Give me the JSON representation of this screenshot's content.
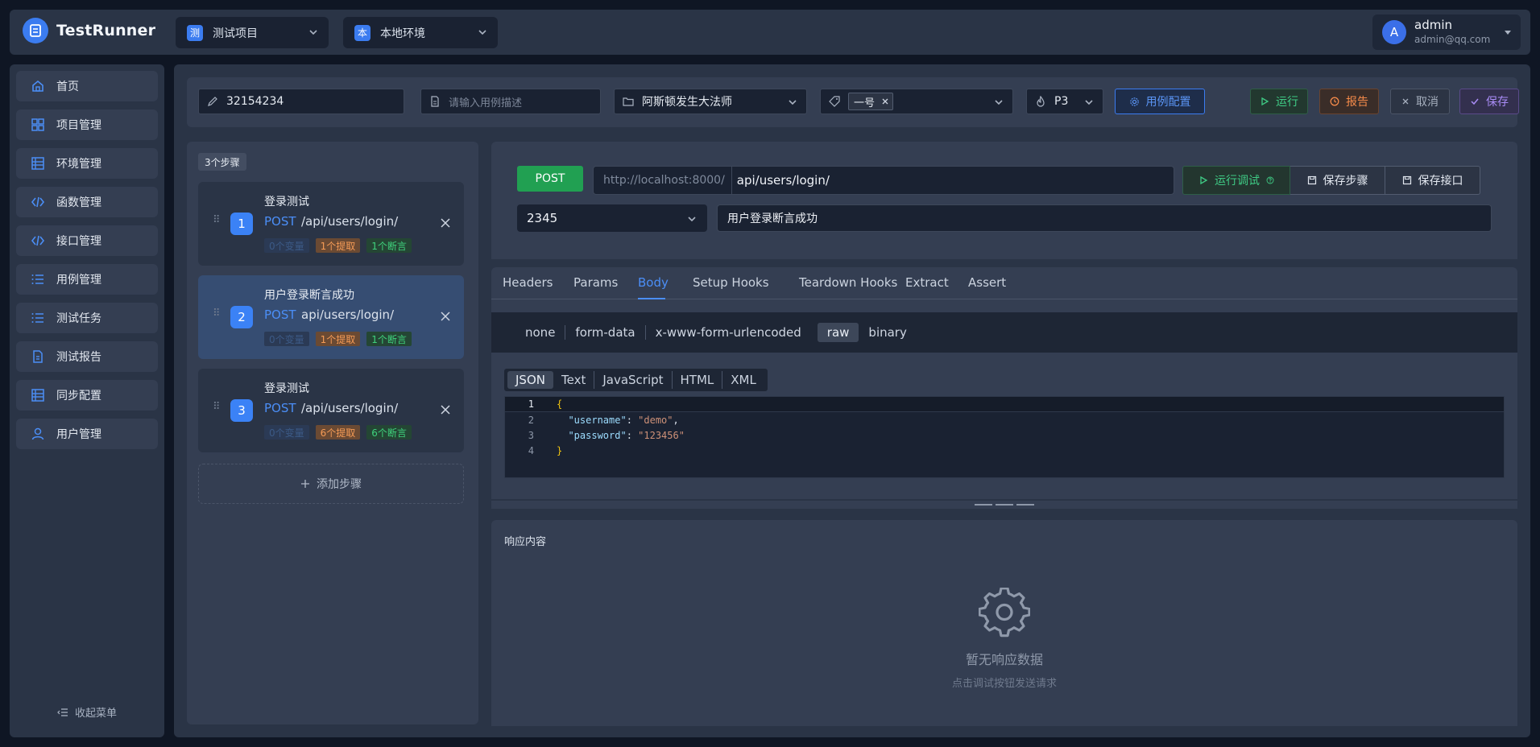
{
  "app": {
    "title": "TestRunner"
  },
  "header": {
    "project": {
      "badge": "测",
      "label": "测试项目"
    },
    "env": {
      "badge": "本",
      "label": "本地环境"
    },
    "user": {
      "avatar": "A",
      "name": "admin",
      "email": "admin@qq.com"
    }
  },
  "sidebar": {
    "items": [
      {
        "label": "首页",
        "icon": "home-icon"
      },
      {
        "label": "项目管理",
        "icon": "grid-icon"
      },
      {
        "label": "环境管理",
        "icon": "database-icon"
      },
      {
        "label": "函数管理",
        "icon": "code-icon"
      },
      {
        "label": "接口管理",
        "icon": "code-icon"
      },
      {
        "label": "用例管理",
        "icon": "list-icon"
      },
      {
        "label": "测试任务",
        "icon": "list-icon"
      },
      {
        "label": "测试报告",
        "icon": "document-icon"
      },
      {
        "label": "同步配置",
        "icon": "database-icon"
      },
      {
        "label": "用户管理",
        "icon": "user-icon"
      }
    ],
    "collapse_label": "收起菜单"
  },
  "toolbar": {
    "case_name": "32154234",
    "desc_placeholder": "请输入用例描述",
    "folder": "阿斯顿发生大法师",
    "tag": "一号",
    "priority": "P3",
    "config_label": "用例配置",
    "run_label": "运行",
    "report_label": "报告",
    "cancel_label": "取消",
    "save_label": "保存"
  },
  "steps": {
    "count_label": "3个步骤",
    "items": [
      {
        "num": "1",
        "name": "登录测试",
        "method": "POST",
        "path": "/api/users/login/",
        "vars": "0个变量",
        "extract": "1个提取",
        "assert": "1个断言"
      },
      {
        "num": "2",
        "name": "用户登录断言成功",
        "method": "POST",
        "path": "api/users/login/",
        "vars": "0个变量",
        "extract": "1个提取",
        "assert": "1个断言"
      },
      {
        "num": "3",
        "name": "登录测试",
        "method": "POST",
        "path": "/api/users/login/",
        "vars": "0个变量",
        "extract": "6个提取",
        "assert": "6个断言"
      }
    ],
    "add_label": "添加步骤"
  },
  "request": {
    "method": "POST",
    "base_url": "http://localhost:8000/",
    "path": "api/users/login/",
    "run_debug_label": "运行调试",
    "save_step_label": "保存步骤",
    "save_api_label": "保存接口",
    "env_value": "2345",
    "step_desc": "用户登录断言成功"
  },
  "tabs": [
    "Headers",
    "Params",
    "Body",
    "Setup Hooks",
    "Teardown Hooks",
    "Extract",
    "Assert"
  ],
  "active_tab": "Body",
  "body_types": [
    "none",
    "form-data",
    "x-www-form-urlencoded",
    "raw",
    "binary"
  ],
  "lang_tabs": [
    "JSON",
    "Text",
    "JavaScript",
    "HTML",
    "XML"
  ],
  "editor": {
    "line_numbers": [
      "1",
      "2",
      "3",
      "4"
    ],
    "open_brace": "{",
    "close_brace": "}",
    "username_key": "\"username\"",
    "username_val": "\"demo\"",
    "password_key": "\"password\"",
    "password_val": "\"123456\""
  },
  "response": {
    "title": "响应内容",
    "empty_title": "暂无响应数据",
    "empty_hint": "点击调试按钮发送请求"
  }
}
